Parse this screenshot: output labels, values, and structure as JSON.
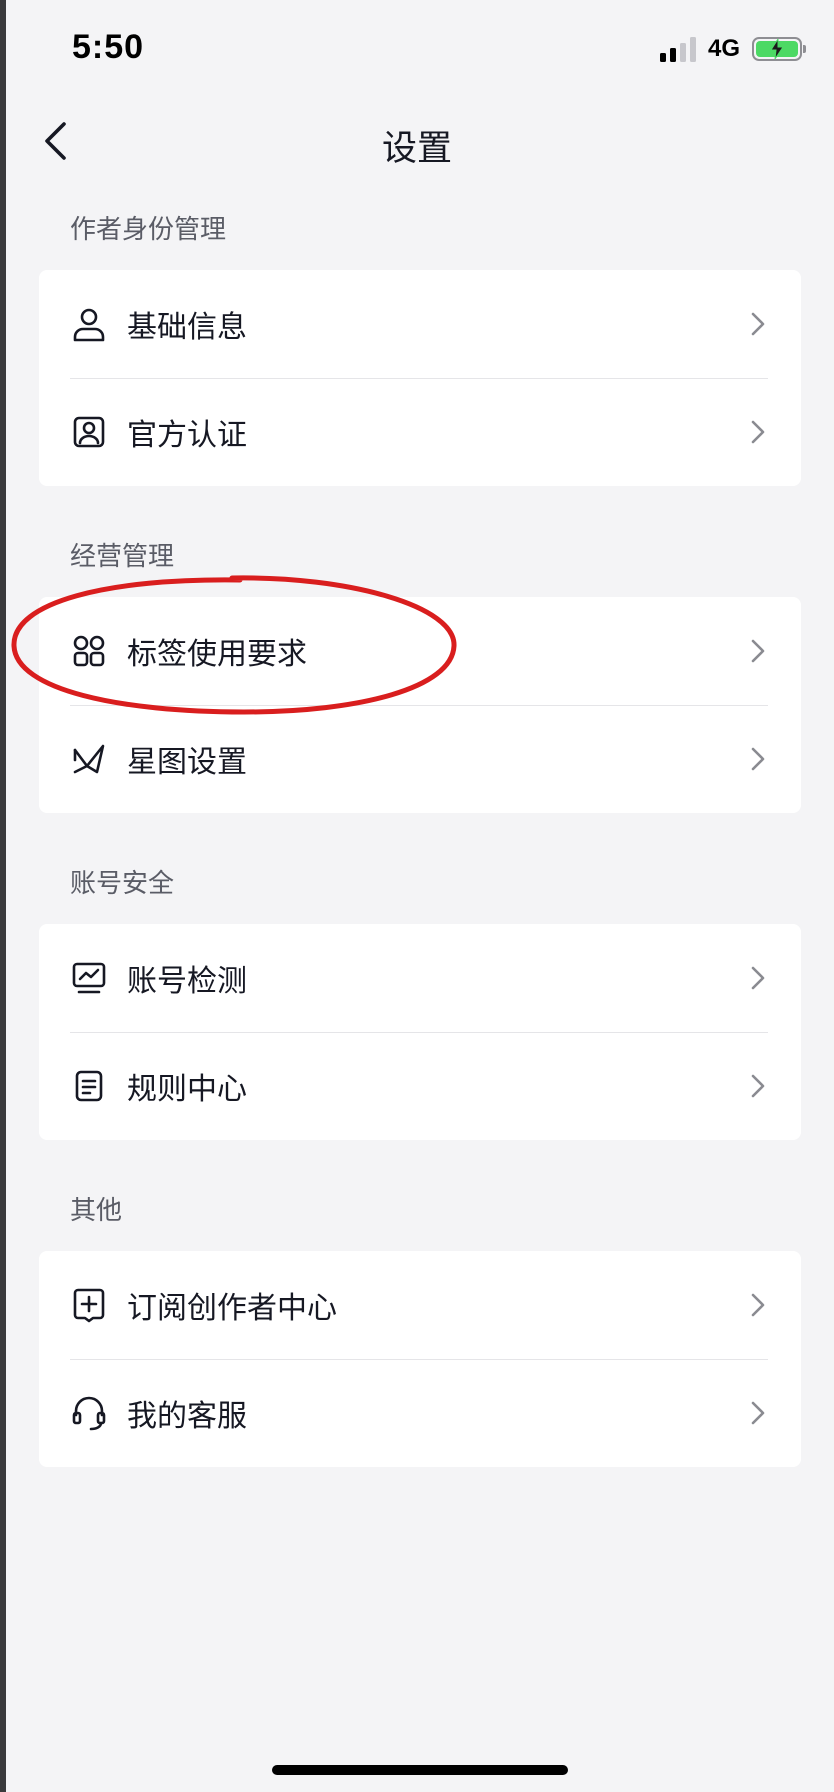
{
  "status_bar": {
    "time": "5:50",
    "network": "4G",
    "signal_icon": "signal-bars-icon",
    "battery_icon": "battery-charging-icon"
  },
  "nav": {
    "title": "设置",
    "back_icon": "chevron-left-icon"
  },
  "sections": [
    {
      "header": "作者身份管理",
      "items": [
        {
          "label": "基础信息",
          "icon": "person-icon"
        },
        {
          "label": "官方认证",
          "icon": "id-badge-icon"
        }
      ]
    },
    {
      "header": "经营管理",
      "items": [
        {
          "label": "标签使用要求",
          "icon": "grid-four-icon"
        },
        {
          "label": "星图设置",
          "icon": "star-map-icon"
        }
      ]
    },
    {
      "header": "账号安全",
      "items": [
        {
          "label": "账号检测",
          "icon": "monitor-chart-icon"
        },
        {
          "label": "规则中心",
          "icon": "document-icon"
        }
      ]
    },
    {
      "header": "其他",
      "items": [
        {
          "label": "订阅创作者中心",
          "icon": "plus-square-icon"
        },
        {
          "label": "我的客服",
          "icon": "headset-icon"
        }
      ]
    }
  ],
  "annotation": {
    "highlighted_item": "标签使用要求",
    "color": "#d91e1e"
  },
  "colors": {
    "background": "#f4f4f6",
    "card": "#ffffff",
    "text_primary": "#161823",
    "text_secondary": "#5a5c66",
    "chevron": "#8a8b91",
    "battery": "#4cd964"
  }
}
